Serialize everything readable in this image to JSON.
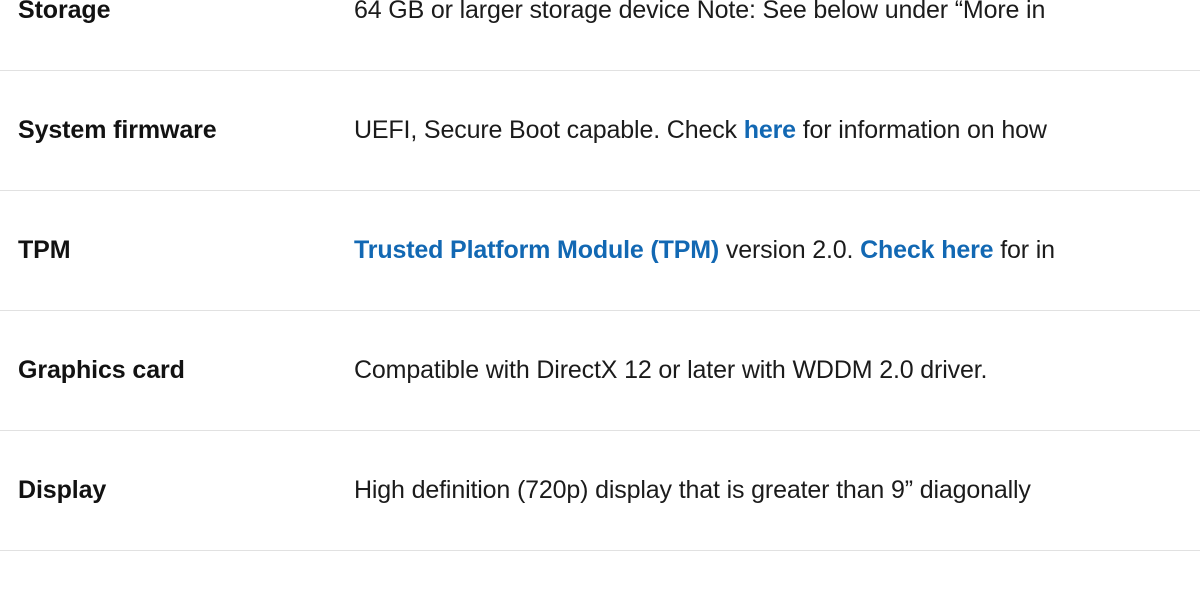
{
  "table": {
    "rows": [
      {
        "label": "Storage",
        "segments": [
          {
            "text": "64 GB or larger storage device Note: See below under “More in",
            "type": "text"
          }
        ]
      },
      {
        "label": "System firmware",
        "segments": [
          {
            "text": "UEFI, Secure Boot capable. Check ",
            "type": "text"
          },
          {
            "text": "here",
            "type": "link"
          },
          {
            "text": " for information on how",
            "type": "text"
          }
        ]
      },
      {
        "label": "TPM",
        "segments": [
          {
            "text": "Trusted Platform Module (TPM)",
            "type": "link"
          },
          {
            "text": " version 2.0. ",
            "type": "text"
          },
          {
            "text": "Check here",
            "type": "link"
          },
          {
            "text": " for in",
            "type": "text"
          }
        ]
      },
      {
        "label": "Graphics card",
        "segments": [
          {
            "text": "Compatible with DirectX 12 or later with WDDM 2.0 driver.",
            "type": "text"
          }
        ]
      },
      {
        "label": "Display",
        "segments": [
          {
            "text": "High definition (720p) display that is greater than 9” diagonally",
            "type": "text"
          }
        ]
      }
    ]
  },
  "colors": {
    "link": "#1268b3",
    "text": "#1b1b1b",
    "label": "#121212",
    "divider": "#e1e1e1",
    "background": "#ffffff"
  }
}
